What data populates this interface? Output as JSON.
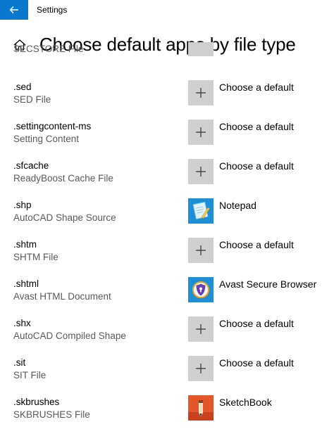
{
  "window": {
    "title": "Settings"
  },
  "header": {
    "title": "Choose default apps by file type"
  },
  "colors": {
    "accent": "#0b78cf",
    "plus_tile": "#cfcfcf"
  },
  "partial_item": {
    "description": "SECSTORE File"
  },
  "items": [
    {
      "ext": ".sed",
      "description": "SED File",
      "app": "Choose a default",
      "icon": "plus-icon"
    },
    {
      "ext": ".settingcontent-ms",
      "description": "Setting Content",
      "app": "Choose a default",
      "icon": "plus-icon"
    },
    {
      "ext": ".sfcache",
      "description": "ReadyBoost Cache File",
      "app": "Choose a default",
      "icon": "plus-icon"
    },
    {
      "ext": ".shp",
      "description": "AutoCAD Shape Source",
      "app": "Notepad",
      "icon": "notepad-icon"
    },
    {
      "ext": ".shtm",
      "description": "SHTM File",
      "app": "Choose a default",
      "icon": "plus-icon"
    },
    {
      "ext": ".shtml",
      "description": "Avast HTML Document",
      "app": "Avast Secure Browser",
      "icon": "avast-secure-browser-icon"
    },
    {
      "ext": ".shx",
      "description": "AutoCAD Compiled Shape",
      "app": "Choose a default",
      "icon": "plus-icon"
    },
    {
      "ext": ".sit",
      "description": "SIT File",
      "app": "Choose a default",
      "icon": "plus-icon"
    },
    {
      "ext": ".skbrushes",
      "description": "SKBRUSHES File",
      "app": "SketchBook",
      "icon": "sketchbook-icon"
    }
  ]
}
